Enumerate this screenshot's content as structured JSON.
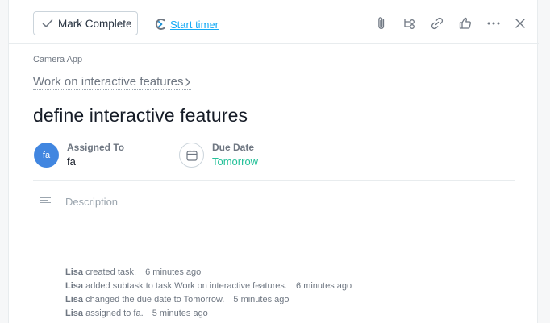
{
  "toolbar": {
    "mark_complete_label": "Mark Complete",
    "start_timer_label": "Start timer"
  },
  "task": {
    "project": "Camera App",
    "parent_task": "Work on interactive features",
    "title": "define interactive features",
    "assignee": {
      "label": "Assigned To",
      "initials": "fa",
      "name": "fa"
    },
    "due_date": {
      "label": "Due Date",
      "value": "Tomorrow"
    },
    "description_placeholder": "Description"
  },
  "activity": [
    {
      "user": "Lisa",
      "text": "created task.",
      "time": "6 minutes ago"
    },
    {
      "user": "Lisa",
      "text": "added subtask to task Work on interactive features.",
      "time": "6 minutes ago"
    },
    {
      "user": "Lisa",
      "text": "changed the due date to Tomorrow.",
      "time": "5 minutes ago"
    },
    {
      "user": "Lisa",
      "text": "assigned to fa.",
      "time": "5 minutes ago"
    }
  ],
  "colors": {
    "accent_link": "#14aaf5",
    "due_date": "#25c199",
    "avatar": "#4186e0"
  },
  "icons": [
    "check-icon",
    "timer-icon",
    "paperclip-icon",
    "subtask-icon",
    "link-icon",
    "like-icon",
    "more-icon",
    "close-icon",
    "chevron-right-icon",
    "calendar-icon",
    "description-icon"
  ]
}
